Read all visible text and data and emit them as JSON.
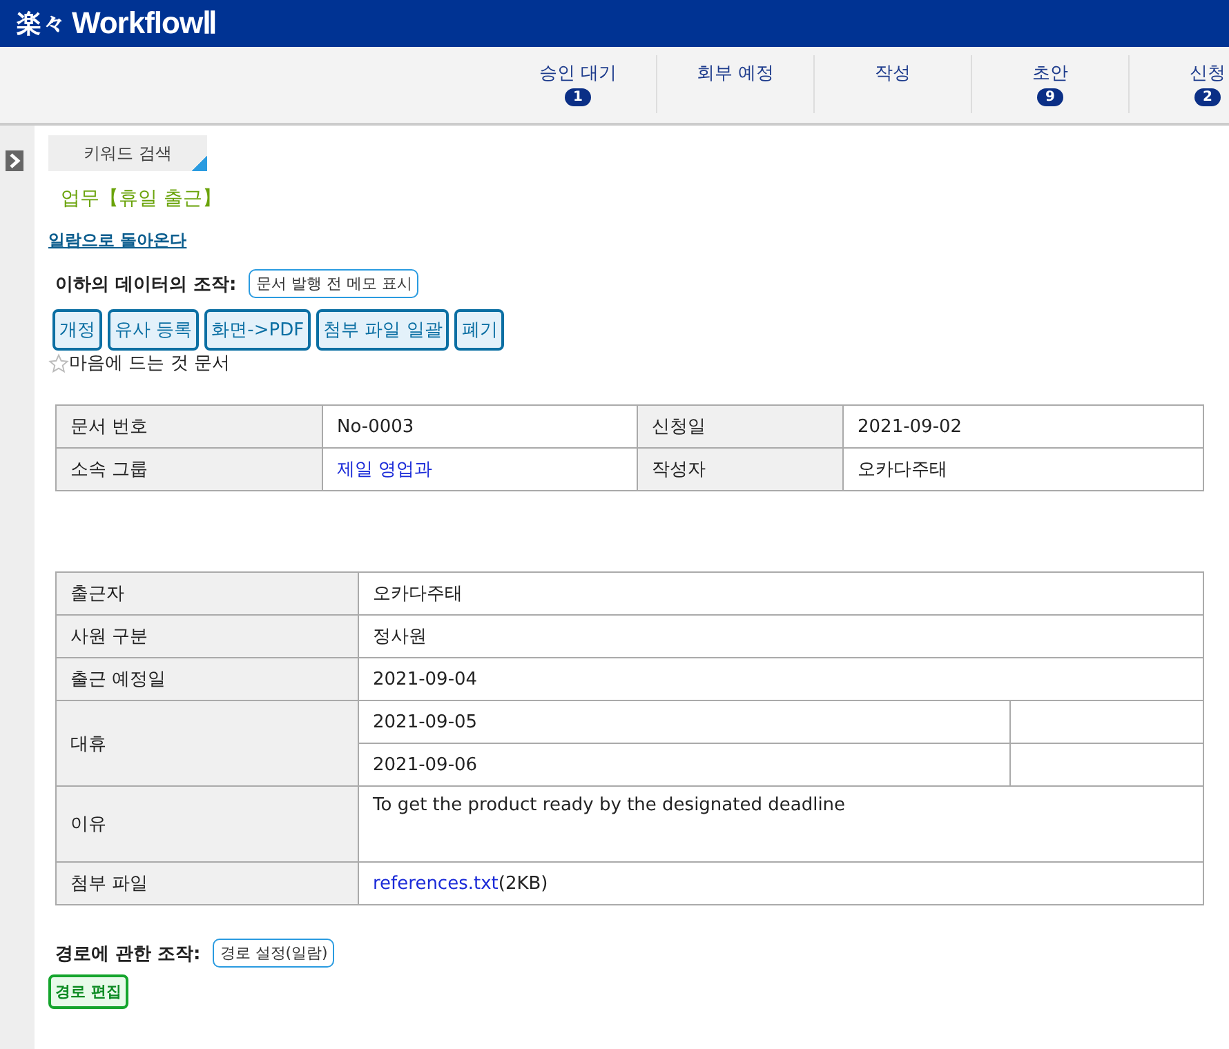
{
  "header": {
    "logo_mark": "楽々",
    "logo_text": "WorkflowⅡ"
  },
  "nav_tabs": [
    {
      "label": "승인 대기",
      "badge": "1"
    },
    {
      "label": "회부 예정"
    },
    {
      "label": "작성"
    },
    {
      "label": "초안",
      "badge": "9"
    },
    {
      "label": "신청",
      "badge": "2"
    }
  ],
  "keyword_search": "키워드 검색",
  "page_title": "업무【휴일 출근】",
  "back_link": "일람으로 돌아온다",
  "data_actions": {
    "label": "이하의 데이터의 조작:",
    "memo_button": "문서 발행 전 메모 표시",
    "buttons": [
      "개정",
      "유사 등록",
      "화면->PDF",
      "첨부 파일 일괄",
      "폐기"
    ]
  },
  "favorite": {
    "label": "마음에 드는 것 문서",
    "on": false
  },
  "doc_info": [
    {
      "label": "문서 번호",
      "value": "No-0003",
      "label2": "신청일",
      "value2": "2021-09-02"
    },
    {
      "label": "소속 그룹",
      "value": "제일 영업과",
      "value_link": true,
      "label2": "작성자",
      "value2": "오카다주태"
    }
  ],
  "form": [
    {
      "label": "출근자",
      "values": [
        "오카다주태"
      ]
    },
    {
      "label": "사원 구분",
      "values": [
        "정사원"
      ]
    },
    {
      "label": "출근 예정일",
      "values": [
        "2021-09-04"
      ]
    },
    {
      "label": "대휴",
      "kind": "multi",
      "values": [
        "2021-09-05",
        "2021-09-06"
      ]
    },
    {
      "label": "이유",
      "kind": "tall",
      "values": [
        "To get  the product ready by the designated deadline"
      ]
    },
    {
      "label": "첨부 파일",
      "kind": "file",
      "file": "references.txt",
      "size": "(2KB)"
    }
  ],
  "route_actions": {
    "label": "경로에 관한 조작:",
    "settings_button": "경로 설정(일람)",
    "edit_button": "경로 편집"
  }
}
